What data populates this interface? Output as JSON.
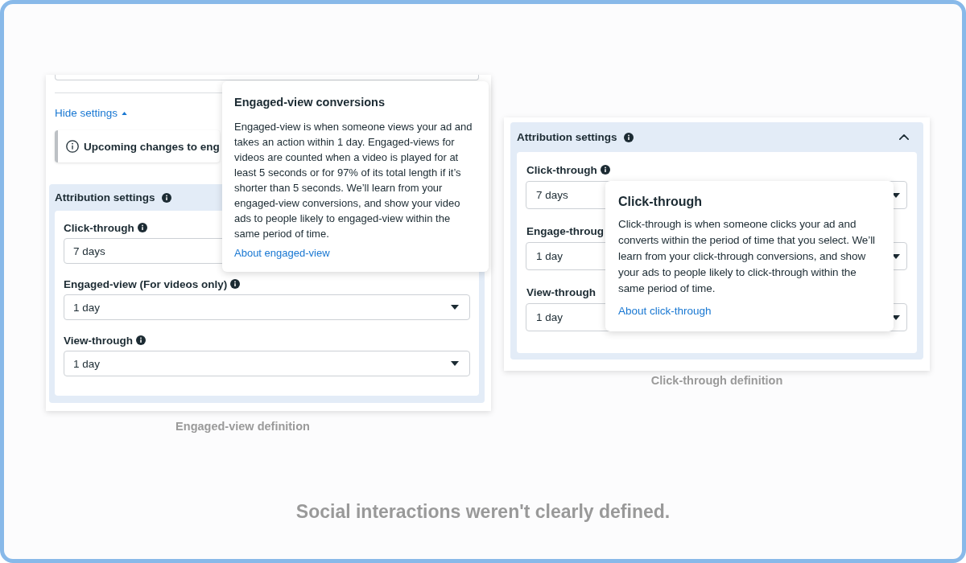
{
  "examples": [
    {
      "kind": "full",
      "link": {
        "label": "Hide settings"
      },
      "notice": {
        "text": "Upcoming changes to eng"
      },
      "section": {
        "title": "Attribution settings",
        "fields": [
          {
            "kind": "caretless",
            "label": "Click-through",
            "value": "7 days"
          },
          {
            "kind": "complete",
            "label": "Engaged-view (For videos only)",
            "value": "1 day"
          },
          {
            "kind": "complete",
            "label": "View-through",
            "value": "1 day"
          }
        ]
      },
      "tooltip": {
        "title": "Engaged-view conversions",
        "body": "Engaged-view is when someone views your ad and takes an action within 1 day. Engaged-views for videos are counted when a video is played for at least 5 seconds or for 97% of its total length if it’s shorter than 5 seconds. We’ll learn from your engaged-view conversions, and show your video ads to people likely to engaged-view within the same period of time.",
        "link": "About engaged-view"
      },
      "caption": "Engaged-view definition"
    },
    {
      "kind": "compact",
      "section": {
        "title": "Attribution settings",
        "expanded": true,
        "fields": [
          {
            "kind": "complete",
            "label": "Click-through",
            "value": "7 days"
          },
          {
            "kind": "iconless",
            "label": "Engage-throug",
            "value": "1 day"
          },
          {
            "kind": "iconless",
            "label": "View-through",
            "value": "1 day"
          }
        ]
      },
      "tooltip": {
        "title": "Click-through",
        "body": "Click-through is when someone clicks your ad and converts within the period of time that you select. We’ll learn from your click-through conversions, and show your ads to people likely to click-through within the same period of time.",
        "link": "About click-through"
      },
      "caption": "Click-through definition"
    }
  ],
  "summary": "Social interactions weren't clearly defined."
}
